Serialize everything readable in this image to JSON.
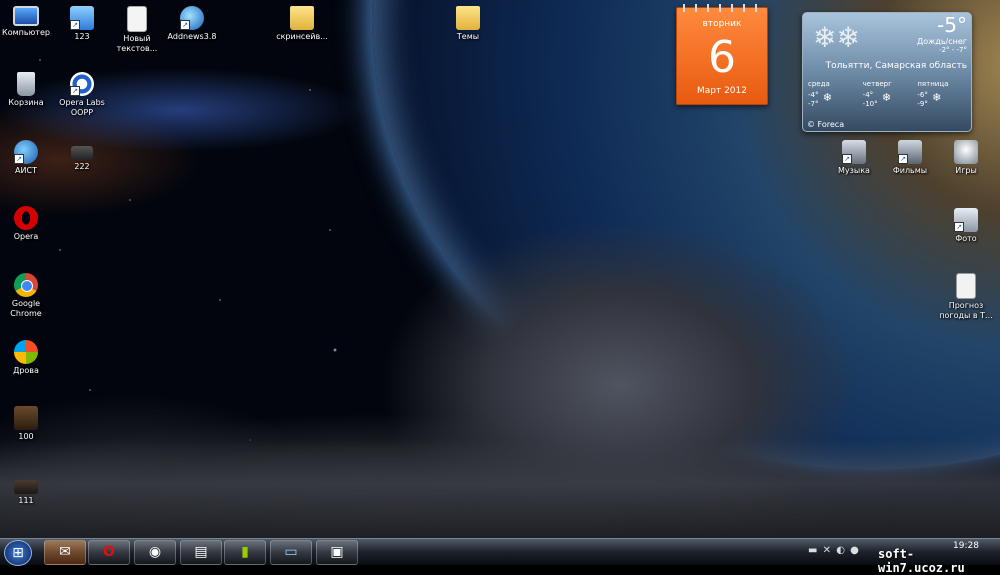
{
  "desktop_icons": {
    "computer": "Компьютер",
    "i123": "123",
    "new_text": "Новый текстов...",
    "addnews": "Addnews3.8",
    "screenshots": "скринсейв...",
    "themes": "Темы",
    "trash": "Корзина",
    "opera_labs": "Opera Labs OOPP",
    "aist": "АИСТ",
    "i222": "222",
    "opera": "Opera",
    "chrome": "Google Chrome",
    "drova": "Дрова",
    "i100": "100",
    "i111": "111",
    "music": "Музыка",
    "films": "Фильмы",
    "games": "Игры",
    "photo": "Фото",
    "forecast": "Прогноз погоды в Т..."
  },
  "calendar": {
    "weekday": "вторник",
    "day": "6",
    "month_year": "Март 2012"
  },
  "weather": {
    "temp": "-5°",
    "condition": "Дождь/снег",
    "range": "-2° - -7°",
    "location": "Тольятти, Самарская область",
    "forecast": [
      {
        "day": "среда",
        "high": "-4°",
        "low": "-7°"
      },
      {
        "day": "четверг",
        "high": "-4°",
        "low": "-10°"
      },
      {
        "day": "пятница",
        "high": "-6°",
        "low": "-9°"
      }
    ],
    "brand": "© Foreca"
  },
  "taskbar": {
    "clock": "19:28",
    "watermark": "soft-win7.ucoz.ru",
    "apps": [
      "mail",
      "opera",
      "globe",
      "notepad",
      "android",
      "explorer",
      "monitor"
    ]
  }
}
